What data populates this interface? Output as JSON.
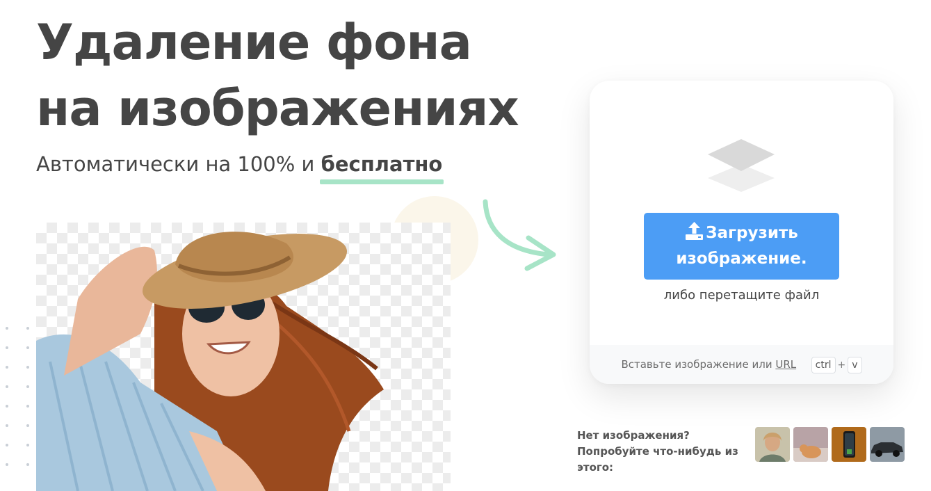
{
  "hero": {
    "title": "Удаление фона на изображениях",
    "subtitle_prefix": "Автоматически на 100% и ",
    "subtitle_highlight": "бесплатно"
  },
  "upload": {
    "button_icon": "upload-icon",
    "button_label": "Загрузить изображение.",
    "drag_hint": "либо перетащите файл",
    "paste_prefix": "Вставьте изображение или ",
    "url_link": "URL",
    "shortcut_key1": "ctrl",
    "shortcut_plus": "+",
    "shortcut_key2": "v"
  },
  "samples": {
    "label": "Нет изображения? Попробуйте что-нибудь из этого:",
    "items": [
      "sample-woman",
      "sample-cat",
      "sample-phone",
      "sample-car"
    ]
  },
  "colors": {
    "primary": "#4c9df5",
    "accent_underline": "#a7e4c7",
    "arrow": "#a7e4c7",
    "text": "#454545"
  }
}
